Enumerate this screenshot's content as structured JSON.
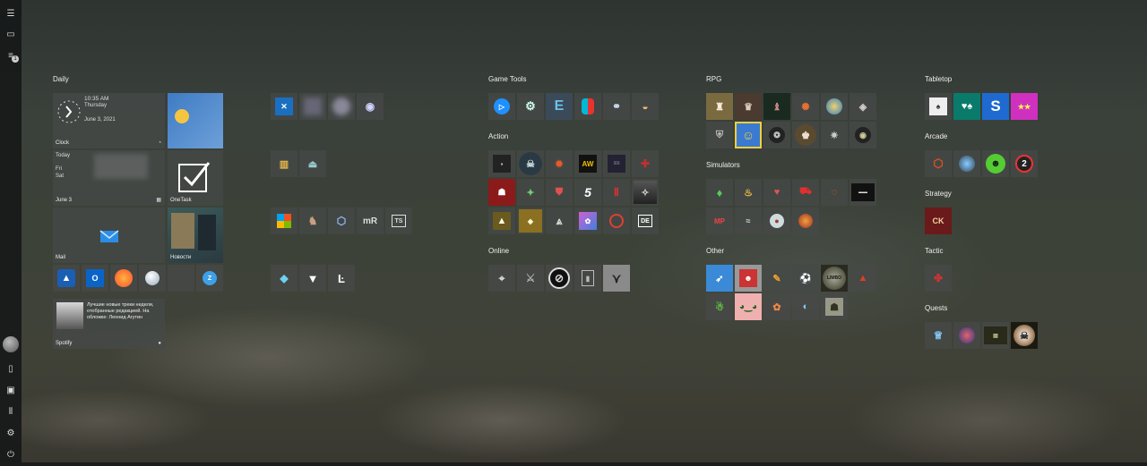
{
  "rail": {
    "icons": [
      "hamburger-menu-icon",
      "all-apps-icon",
      "list-icon",
      "documents-icon",
      "pictures-icon",
      "library-icon",
      "settings-icon",
      "power-icon"
    ],
    "badge": "1"
  },
  "groups": {
    "daily": "Daily",
    "game_tools": "Game Tools",
    "action": "Action",
    "online": "Online",
    "rpg": "RPG",
    "simulators": "Simulators",
    "other": "Other",
    "tabletop": "Tabletop",
    "arcade": "Arcade",
    "strategy": "Strategy",
    "tactic": "Tactic",
    "quests": "Quests"
  },
  "clock": {
    "time": "10:35 AM",
    "day": "Thursday",
    "date": "June 3, 2021",
    "label": "Clock"
  },
  "calendar": {
    "today": "Today",
    "fri": "Fri",
    "sat": "Sat",
    "label": "June 3"
  },
  "onetask": {
    "label": "OneTask"
  },
  "mail": {
    "label": "Mail"
  },
  "news": {
    "label": "Новости"
  },
  "spotify": {
    "text": "Лучшие новые треки недели, отобранные редакцией. На обложке: Леонид Агутин",
    "label": "Spotify"
  },
  "tile_text": {
    "mr": "mR",
    "t5": "5",
    "aw": "AW",
    "limbo": "LIMBO",
    "tabletop_s": "S",
    "arcade_2": "2",
    "strategy_ck": "CK"
  },
  "colors": {
    "accent": "#1e90ff",
    "edge_tile": "#0078d7",
    "discord": "#5865f2",
    "firefox": "#ff7139",
    "red_dead": "#8b1a1a"
  }
}
